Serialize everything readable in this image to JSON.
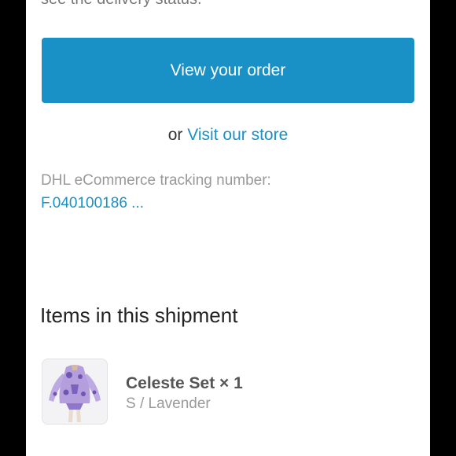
{
  "email": {
    "cut_text": "see the delivery status.",
    "view_order_label": "View your order",
    "or_text": "or",
    "visit_store_label": "Visit our store",
    "tracking_label": "DHL eCommerce tracking number:",
    "tracking_number": "F.040100186 ...",
    "shipment_title": "Items in this shipment",
    "item": {
      "name": "Celeste Set × 1",
      "variant": "S / Lavender"
    }
  },
  "colors": {
    "accent": "#1990c6",
    "background": "#000000",
    "card": "#ffffff"
  }
}
